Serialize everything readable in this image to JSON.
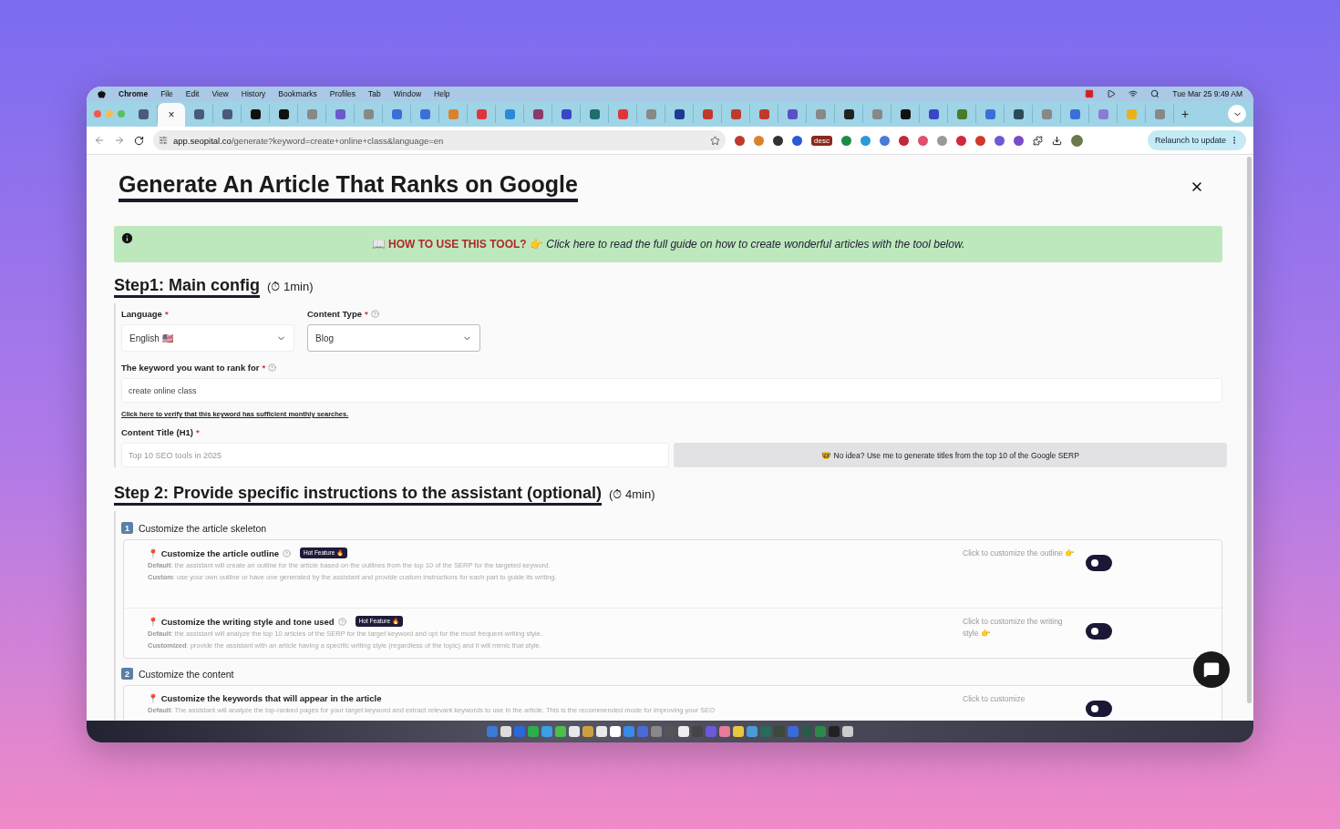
{
  "menu_bar": {
    "items": [
      "Chrome",
      "File",
      "Edit",
      "View",
      "History",
      "Bookmarks",
      "Profiles",
      "Tab",
      "Window",
      "Help"
    ],
    "clock": "Tue Mar 25  9:49 AM"
  },
  "tabs": [
    {
      "selected": false,
      "color": "#4a5a7a"
    },
    {
      "selected": true,
      "close": "×"
    },
    {
      "selected": false,
      "color": "#4a5a7a"
    },
    {
      "selected": false,
      "color": "#4a5a7a"
    },
    {
      "selected": false,
      "color": "#111111"
    },
    {
      "selected": false,
      "color": "#111111"
    },
    {
      "selected": false,
      "color": "#888888"
    },
    {
      "selected": false,
      "color": "#6a5acd"
    },
    {
      "selected": false,
      "color": "#888888"
    },
    {
      "selected": false,
      "color": "#3b6fd8"
    },
    {
      "selected": false,
      "color": "#3b6fd8"
    },
    {
      "selected": false,
      "color": "#d9822b"
    },
    {
      "selected": false,
      "color": "#e0343c"
    },
    {
      "selected": false,
      "color": "#2a8ad8"
    },
    {
      "selected": false,
      "color": "#8a3a6a"
    },
    {
      "selected": false,
      "color": "#3a46c8"
    },
    {
      "selected": false,
      "color": "#1e6e6e"
    },
    {
      "selected": false,
      "color": "#e0343c"
    },
    {
      "selected": false,
      "color": "#888888"
    },
    {
      "selected": false,
      "color": "#1f3a93"
    },
    {
      "selected": false,
      "color": "#c0392b"
    },
    {
      "selected": false,
      "color": "#c0392b"
    },
    {
      "selected": false,
      "color": "#c0392b"
    },
    {
      "selected": false,
      "color": "#5b4fc8"
    },
    {
      "selected": false,
      "color": "#888888"
    },
    {
      "selected": false,
      "color": "#222222"
    },
    {
      "selected": false,
      "color": "#888888"
    },
    {
      "selected": false,
      "color": "#111111"
    },
    {
      "selected": false,
      "color": "#3a46c8"
    },
    {
      "selected": false,
      "color": "#4a7a2a"
    },
    {
      "selected": false,
      "color": "#3b6fd8"
    },
    {
      "selected": false,
      "color": "#2b4b5b"
    },
    {
      "selected": false,
      "color": "#888888"
    },
    {
      "selected": false,
      "color": "#3b6fd8"
    },
    {
      "selected": false,
      "color": "#8a7ad8"
    },
    {
      "selected": false,
      "color": "#e8b21a"
    },
    {
      "selected": false,
      "color": "#888888"
    }
  ],
  "new_tab": "+",
  "address_bar": {
    "domain": "app.seopital.co",
    "path": "/generate?keyword=create+online+class&language=en"
  },
  "extensions": [
    {
      "color": "#c0392b"
    },
    {
      "color": "#d9822b"
    },
    {
      "color": "#333333"
    },
    {
      "color": "#2a5ad8"
    },
    {
      "color": "#8a2a1a",
      "label": "desc"
    },
    {
      "color": "#1e8a4a"
    },
    {
      "color": "#2a9ad8"
    },
    {
      "color": "#4a7ad8"
    },
    {
      "color": "#c0283c"
    },
    {
      "color": "#e0506a"
    },
    {
      "color": "#999999"
    },
    {
      "color": "#d0283c"
    },
    {
      "color": "#d0382c"
    },
    {
      "color": "#6a5ad8"
    },
    {
      "color": "#7a4ac8"
    }
  ],
  "relaunch_button": "Relaunch to update",
  "page": {
    "title": "Generate An Article That Ranks on Google",
    "guide_banner": {
      "heading": "📖 HOW TO USE THIS TOOL? 👉",
      "text": "Click here to read the full guide on how to create wonderful articles with the tool below."
    },
    "step1": {
      "heading": "Step1: Main config",
      "duration": "(⏱ 1min)",
      "language": {
        "label": "Language",
        "required": "*",
        "value": "English 🇺🇸"
      },
      "content_type": {
        "label": "Content Type",
        "required": "*",
        "value": "Blog"
      },
      "keyword": {
        "label": "The keyword you want to rank for",
        "required": "*",
        "value": "create online class"
      },
      "verify_link": "Click here to verify that this keyword has sufficient monthly searches.",
      "content_title": {
        "label": "Content Title (H1)",
        "required": "*",
        "placeholder": "Top 10 SEO tools in 2025"
      },
      "generate_titles_button": "🤓 No idea? Use me to generate titles from the top 10 of the Google SERP"
    },
    "step2": {
      "heading": "Step 2: Provide specific instructions to the assistant (optional)",
      "duration": "(⏱ 4min)",
      "sections": [
        {
          "number": "1",
          "title": "Customize the article skeleton",
          "options": [
            {
              "title": "📍 Customize the article outline",
              "help": true,
              "badge": "Hot Feature 🔥",
              "lines": [
                "**Default**: the assistant will create an outline for the article based on the outlines from the top 10 of the SERP for the targeted keyword.",
                "**Custom**: use your own outline or have one generated by the assistant and provide custom instructions for each part to guide its writing."
              ],
              "toggle_label": "Click to customize the outline 👉",
              "on": false
            },
            {
              "title": "📍 Customize the writing style and tone used",
              "help": true,
              "badge": "Hot Feature 🔥",
              "lines": [
                "**Default**: the assistant will analyze the top 10 articles of the SERP for the target keyword and opt for the most frequent writing style.",
                "**Customized**: provide the assistant with an article having a specific writing style (regardless of the topic) and it will mimic that style."
              ],
              "toggle_label": "Click to customize the writing style 👉",
              "on": false
            }
          ]
        },
        {
          "number": "2",
          "title": "Customize the content",
          "options": [
            {
              "title": "📍 Customize the keywords that will appear in the article",
              "help": false,
              "lines": [
                "**Default**: The assistant will analyze the top-ranked pages for your target keyword and extract relevant keywords to use in the article. This is the recommended mode for improving your SEO"
              ],
              "toggle_label": "Click to customize",
              "on": false
            }
          ]
        }
      ]
    }
  }
}
